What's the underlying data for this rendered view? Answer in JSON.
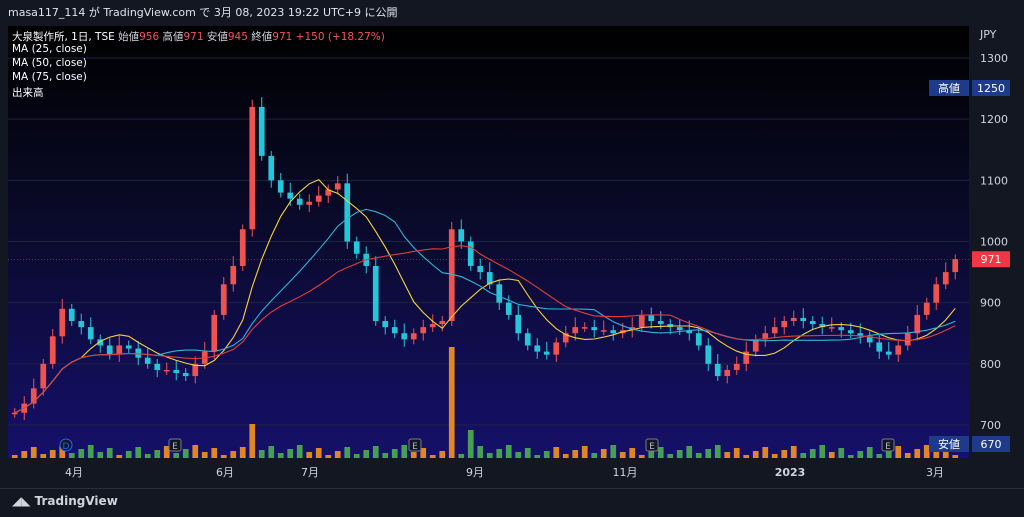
{
  "header": {
    "publisher": "masa117_114 が TradingView.com で 3月 08, 2023 19:22 UTC+9 に公開"
  },
  "legend": {
    "symbol": "大泉製作所, 1日, TSE",
    "open_label": "始値",
    "open_value": "956",
    "high_label": "高値",
    "high_value": "971",
    "low_label": "安値",
    "low_value": "945",
    "close_label": "終値",
    "close_value": "971",
    "change": "+150 (+18.27%)",
    "ma25": "MA (25, close)",
    "ma50": "MA (50, close)",
    "ma75": "MA (75, close)",
    "volume": "出来高"
  },
  "currency": "JPY",
  "price_tags": {
    "high_label": "高値",
    "high_value": "1250",
    "last_value": "971",
    "low_label": "安値",
    "low_value": "670"
  },
  "markers": [
    "D",
    "E",
    "E",
    "E",
    "E"
  ],
  "branding": "TradingView",
  "colors": {
    "up": "#f23645",
    "down": "#22ab94",
    "candle_up": "#ef5350",
    "candle_down": "#26c6da",
    "ma25": "#f5d33b",
    "ma50": "#2fb5d6",
    "ma75": "#e03c3c",
    "vol_up": "#f7931e",
    "vol_down": "#4caf50",
    "tag_blue": "#1e3a8a",
    "tag_red": "#f23645"
  },
  "chart_data": {
    "type": "candlestick",
    "title": "大泉製作所, 1日, TSE",
    "ylim": [
      670,
      1320
    ],
    "y_ticks": [
      700,
      800,
      900,
      1000,
      1100,
      1200,
      1300
    ],
    "x_tick_labels": [
      "4月",
      "6月",
      "7月",
      "9月",
      "11月",
      "2023",
      "3月"
    ],
    "closes": [
      720,
      735,
      760,
      800,
      845,
      890,
      870,
      860,
      840,
      830,
      815,
      830,
      825,
      810,
      800,
      790,
      790,
      785,
      780,
      800,
      820,
      880,
      930,
      960,
      1020,
      1220,
      1140,
      1100,
      1080,
      1070,
      1060,
      1065,
      1075,
      1085,
      1095,
      1000,
      980,
      960,
      870,
      860,
      850,
      840,
      850,
      860,
      865,
      870,
      1020,
      1000,
      960,
      950,
      930,
      900,
      880,
      850,
      830,
      820,
      815,
      835,
      850,
      860,
      860,
      855,
      855,
      850,
      855,
      860,
      880,
      870,
      865,
      860,
      855,
      850,
      830,
      800,
      780,
      790,
      800,
      820,
      840,
      850,
      860,
      870,
      875,
      870,
      865,
      860,
      860,
      855,
      850,
      845,
      835,
      820,
      815,
      830,
      850,
      880,
      900,
      930,
      950,
      971
    ],
    "series": [
      {
        "name": "MA (25, close)"
      },
      {
        "name": "MA (50, close)"
      },
      {
        "name": "MA (75, close)"
      },
      {
        "name": "出来高"
      }
    ],
    "grid": false
  }
}
